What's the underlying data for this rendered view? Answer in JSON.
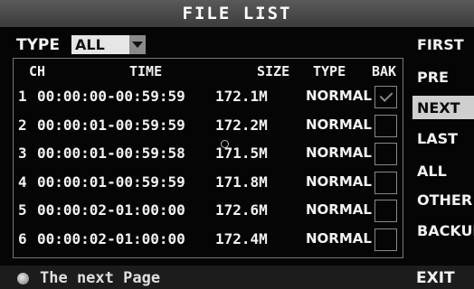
{
  "title": "FILE LIST",
  "type_filter": {
    "label": "TYPE",
    "value": "ALL"
  },
  "table": {
    "headers": {
      "ch": "CH",
      "time": "TIME",
      "size": "SIZE",
      "type": "TYPE",
      "bak": "BAK"
    },
    "rows": [
      {
        "ch": "1",
        "time": "00:00:00-00:59:59",
        "size": "172.1M",
        "type": "NORMAL",
        "bak": true
      },
      {
        "ch": "2",
        "time": "00:00:01-00:59:59",
        "size": "172.2M",
        "type": "NORMAL",
        "bak": false
      },
      {
        "ch": "3",
        "time": "00:00:01-00:59:58",
        "size": "171.5M",
        "type": "NORMAL",
        "bak": false
      },
      {
        "ch": "4",
        "time": "00:00:01-00:59:59",
        "size": "171.8M",
        "type": "NORMAL",
        "bak": false
      },
      {
        "ch": "5",
        "time": "00:00:02-01:00:00",
        "size": "172.6M",
        "type": "NORMAL",
        "bak": false
      },
      {
        "ch": "6",
        "time": "00:00:02-01:00:00",
        "size": "172.4M",
        "type": "NORMAL",
        "bak": false
      }
    ]
  },
  "side_buttons": [
    {
      "label": "FIRST",
      "selected": false
    },
    {
      "label": "PRE",
      "selected": false
    },
    {
      "label": "NEXT",
      "selected": true
    },
    {
      "label": "LAST",
      "selected": false
    },
    {
      "label": "ALL",
      "selected": false
    },
    {
      "label": "OTHER",
      "selected": false
    },
    {
      "label": "BACKUP",
      "selected": false
    }
  ],
  "footer": {
    "hint": "The next Page",
    "exit_label": "EXIT"
  },
  "icons": {
    "dropdown": "chevron-down-icon",
    "indicator": "led-indicator-icon",
    "checkbox": "checkbox-icon"
  },
  "colors": {
    "background": "#050505",
    "title_bar": "#4a4a4a",
    "selected": "#cfcfcf",
    "text": "#f2f2f2"
  }
}
